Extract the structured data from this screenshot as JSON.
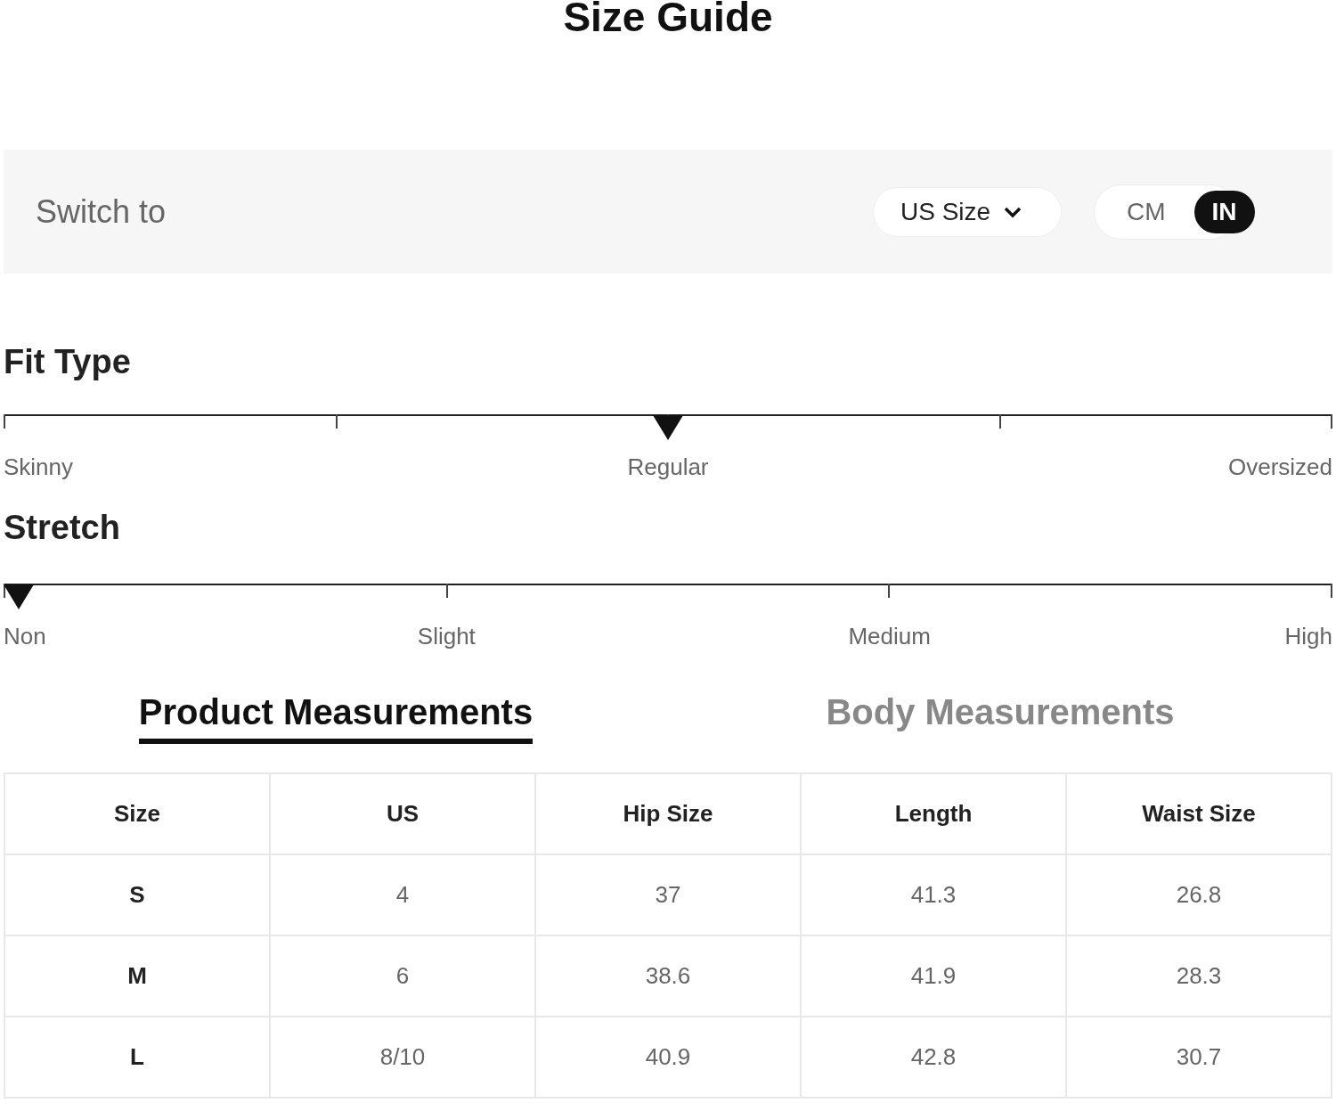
{
  "title": "Size Guide",
  "switch_bar": {
    "label": "Switch to",
    "size_system": "US Size",
    "units": [
      {
        "label": "CM",
        "selected": false
      },
      {
        "label": "IN",
        "selected": true
      }
    ]
  },
  "scales": [
    {
      "title": "Fit Type",
      "kind": "quarters",
      "level": 0.5,
      "labels": [
        "Skinny",
        "Regular",
        "Oversized"
      ]
    },
    {
      "title": "Stretch",
      "kind": "thirds",
      "level": 0,
      "labels": [
        "Non",
        "Slight",
        "Medium",
        "High"
      ]
    }
  ],
  "tabs": [
    {
      "label": "Product Measurements",
      "selected": true
    },
    {
      "label": "Body Measurements",
      "selected": false
    }
  ],
  "table": {
    "columns": [
      "Size",
      "US",
      "Hip Size",
      "Length",
      "Waist Size"
    ],
    "rows": [
      [
        "S",
        "4",
        "37",
        "41.3",
        "26.8"
      ],
      [
        "M",
        "6",
        "38.6",
        "41.9",
        "28.3"
      ],
      [
        "L",
        "8/10",
        "40.9",
        "42.8",
        "30.7"
      ]
    ]
  }
}
